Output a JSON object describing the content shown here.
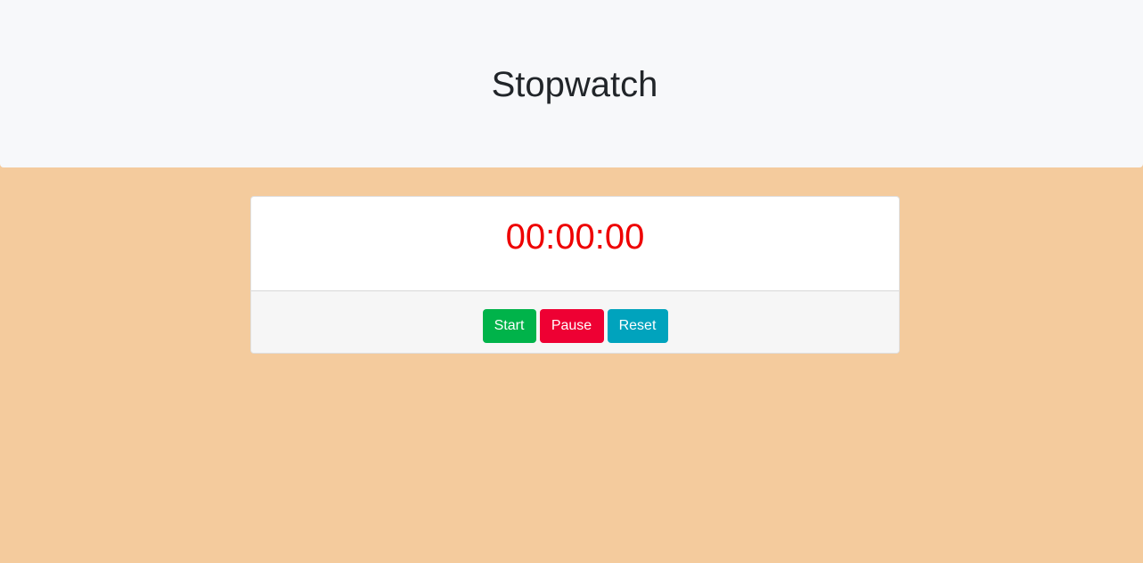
{
  "header": {
    "title": "Stopwatch"
  },
  "stopwatch": {
    "time": "00:00:00"
  },
  "controls": {
    "start_label": "Start",
    "pause_label": "Pause",
    "reset_label": "Reset"
  },
  "colors": {
    "page_background": "#f4cb9d",
    "header_background": "#f7f8fa",
    "time_color": "#ee0000",
    "start_button": "#00b34a",
    "pause_button": "#ee0033",
    "reset_button": "#00a3bd"
  }
}
